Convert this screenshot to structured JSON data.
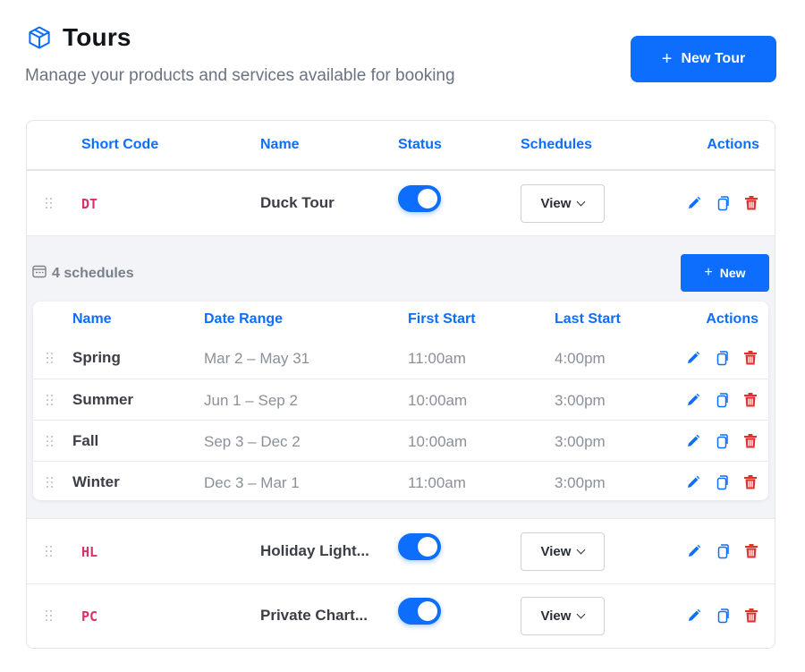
{
  "page": {
    "title": "Tours",
    "subtitle": "Manage your products and services available for booking",
    "new_tour_label": "New Tour",
    "plus_glyph": "+",
    "title_icon": "box-icon"
  },
  "tours_table": {
    "headers": [
      "Short Code",
      "Name",
      "Status",
      "Schedules",
      "Actions"
    ],
    "view_label": "View",
    "rows": [
      {
        "code": "DT",
        "name": "Duck Tour",
        "status": "on"
      },
      {
        "code": "HL",
        "name": "Holiday Light...",
        "status": "on"
      },
      {
        "code": "PC",
        "name": "Private Chart...",
        "status": "on"
      }
    ]
  },
  "schedules": {
    "count_label": "4 schedules",
    "new_label": "New",
    "headers": [
      "Name",
      "Date Range",
      "First Start",
      "Last Start",
      "Actions"
    ],
    "rows": [
      {
        "name": "Spring",
        "range": "Mar 2 – May 31",
        "first": "11:00am",
        "last": "4:00pm"
      },
      {
        "name": "Summer",
        "range": "Jun 1 – Sep 2",
        "first": "10:00am",
        "last": "3:00pm"
      },
      {
        "name": "Fall",
        "range": "Sep 3 – Dec 2",
        "first": "10:00am",
        "last": "3:00pm"
      },
      {
        "name": "Winter",
        "range": "Dec 3 – Mar 1",
        "first": "11:00am",
        "last": "3:00pm"
      }
    ]
  },
  "colors": {
    "primary": "#0d6efd",
    "code_pink": "#d6336c",
    "delete_red": "#e03131"
  },
  "icons": [
    "box-icon",
    "drag-handle-icon",
    "pencil-icon",
    "copy-icon",
    "trash-icon",
    "calendar-icon",
    "chevron-down-icon",
    "plus-icon"
  ]
}
